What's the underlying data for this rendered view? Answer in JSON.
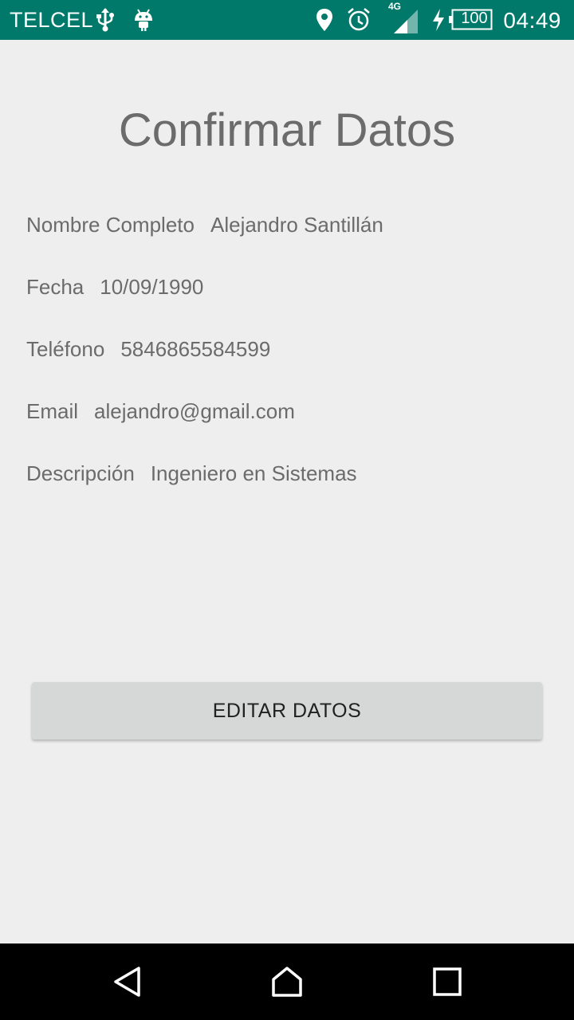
{
  "status_bar": {
    "carrier": "TELCEL",
    "network_type": "4G",
    "battery_level": "100",
    "time": "04:49",
    "icons": [
      "usb-icon",
      "android-icon",
      "location-icon",
      "alarm-icon",
      "signal-icon",
      "charging-icon",
      "battery-icon"
    ]
  },
  "screen": {
    "title": "Confirmar Datos",
    "fields": [
      {
        "label": "Nombre Completo",
        "value": "Alejandro Santillán"
      },
      {
        "label": "Fecha",
        "value": "10/09/1990"
      },
      {
        "label": "Teléfono",
        "value": "5846865584599"
      },
      {
        "label": "Email",
        "value": "alejandro@gmail.com"
      },
      {
        "label": "Descripción",
        "value": "Ingeniero en Sistemas"
      }
    ],
    "edit_button_label": "EDITAR DATOS"
  },
  "nav_bar": {
    "icons": [
      "back-icon",
      "home-icon",
      "recents-icon"
    ]
  },
  "colors": {
    "status_bar": "#00796b",
    "background": "#eeeeee",
    "text": "#6b6b6b",
    "button": "#d6d7d7"
  }
}
